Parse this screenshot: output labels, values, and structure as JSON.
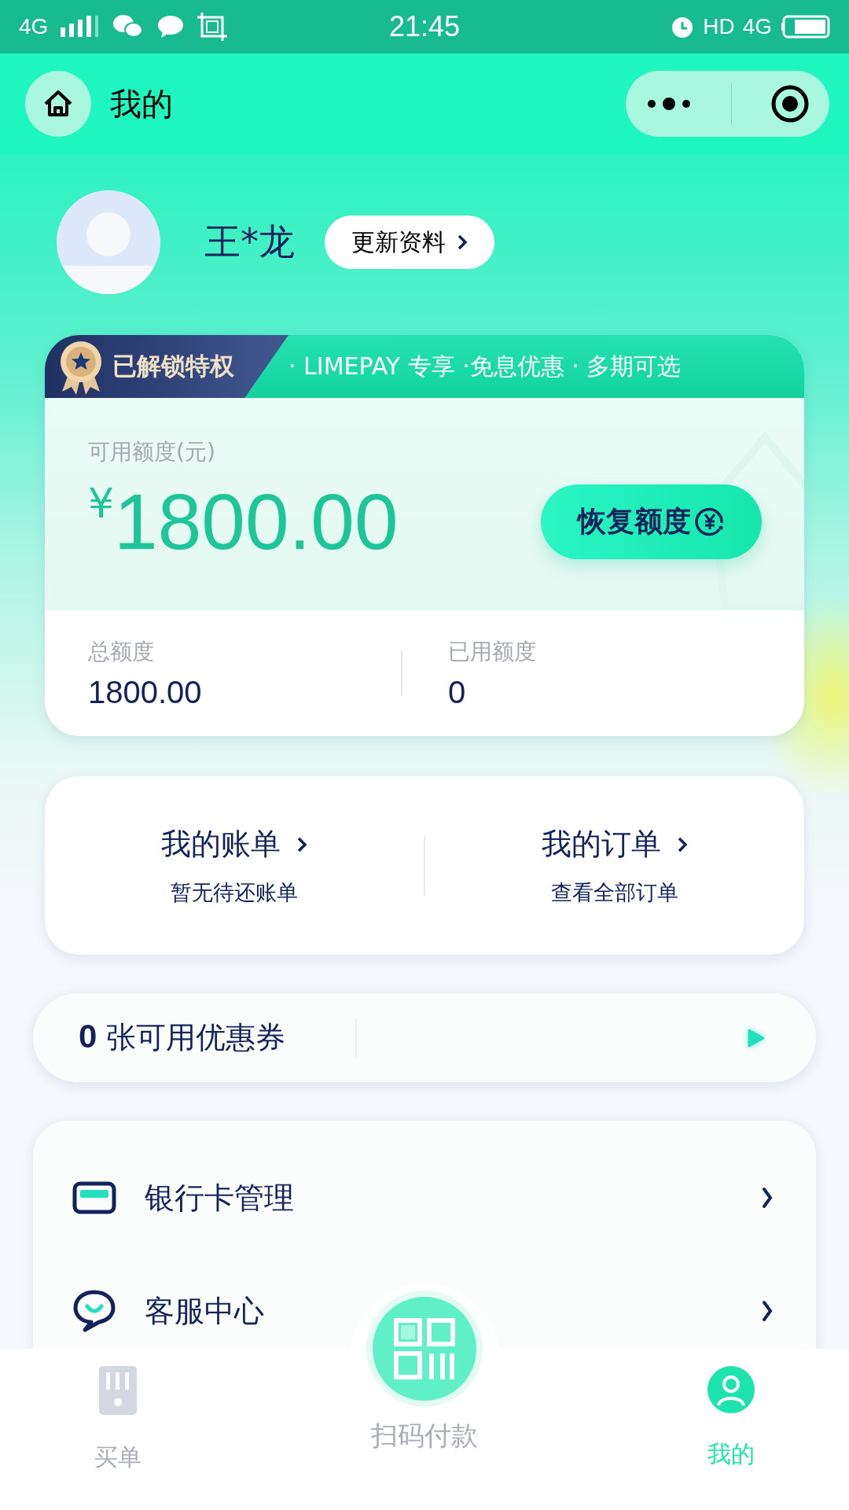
{
  "status_bar": {
    "network": "4G",
    "time": "21:45",
    "hd": "HD",
    "network_right": "4G"
  },
  "header": {
    "title": "我的"
  },
  "profile": {
    "name": "王*龙",
    "update_button": "更新资料"
  },
  "credit_card": {
    "badge": "已解锁特权",
    "perks": "· LIMEPAY 专享 ·免息优惠 · 多期可选",
    "available_label": "可用额度(元)",
    "currency": "¥",
    "available_amount": "1800.00",
    "restore_button": "恢复额度",
    "stats": [
      {
        "label": "总额度",
        "value": "1800.00"
      },
      {
        "label": "已用额度",
        "value": "0"
      }
    ]
  },
  "shortcuts": [
    {
      "title": "我的账单",
      "subtitle": "暂无待还账单"
    },
    {
      "title": "我的订单",
      "subtitle": "查看全部订单"
    }
  ],
  "coupons": {
    "count": "0",
    "label": "张可用优惠券"
  },
  "menu": [
    {
      "kind": "card",
      "label": "银行卡管理"
    },
    {
      "kind": "chat",
      "label": "客服中心"
    }
  ],
  "bottom_nav": [
    {
      "kind": "phone",
      "label": "买单",
      "selected": false
    },
    {
      "kind": "scan",
      "label": "扫码付款",
      "selected": false
    },
    {
      "kind": "user",
      "label": "我的",
      "selected": true
    }
  ]
}
